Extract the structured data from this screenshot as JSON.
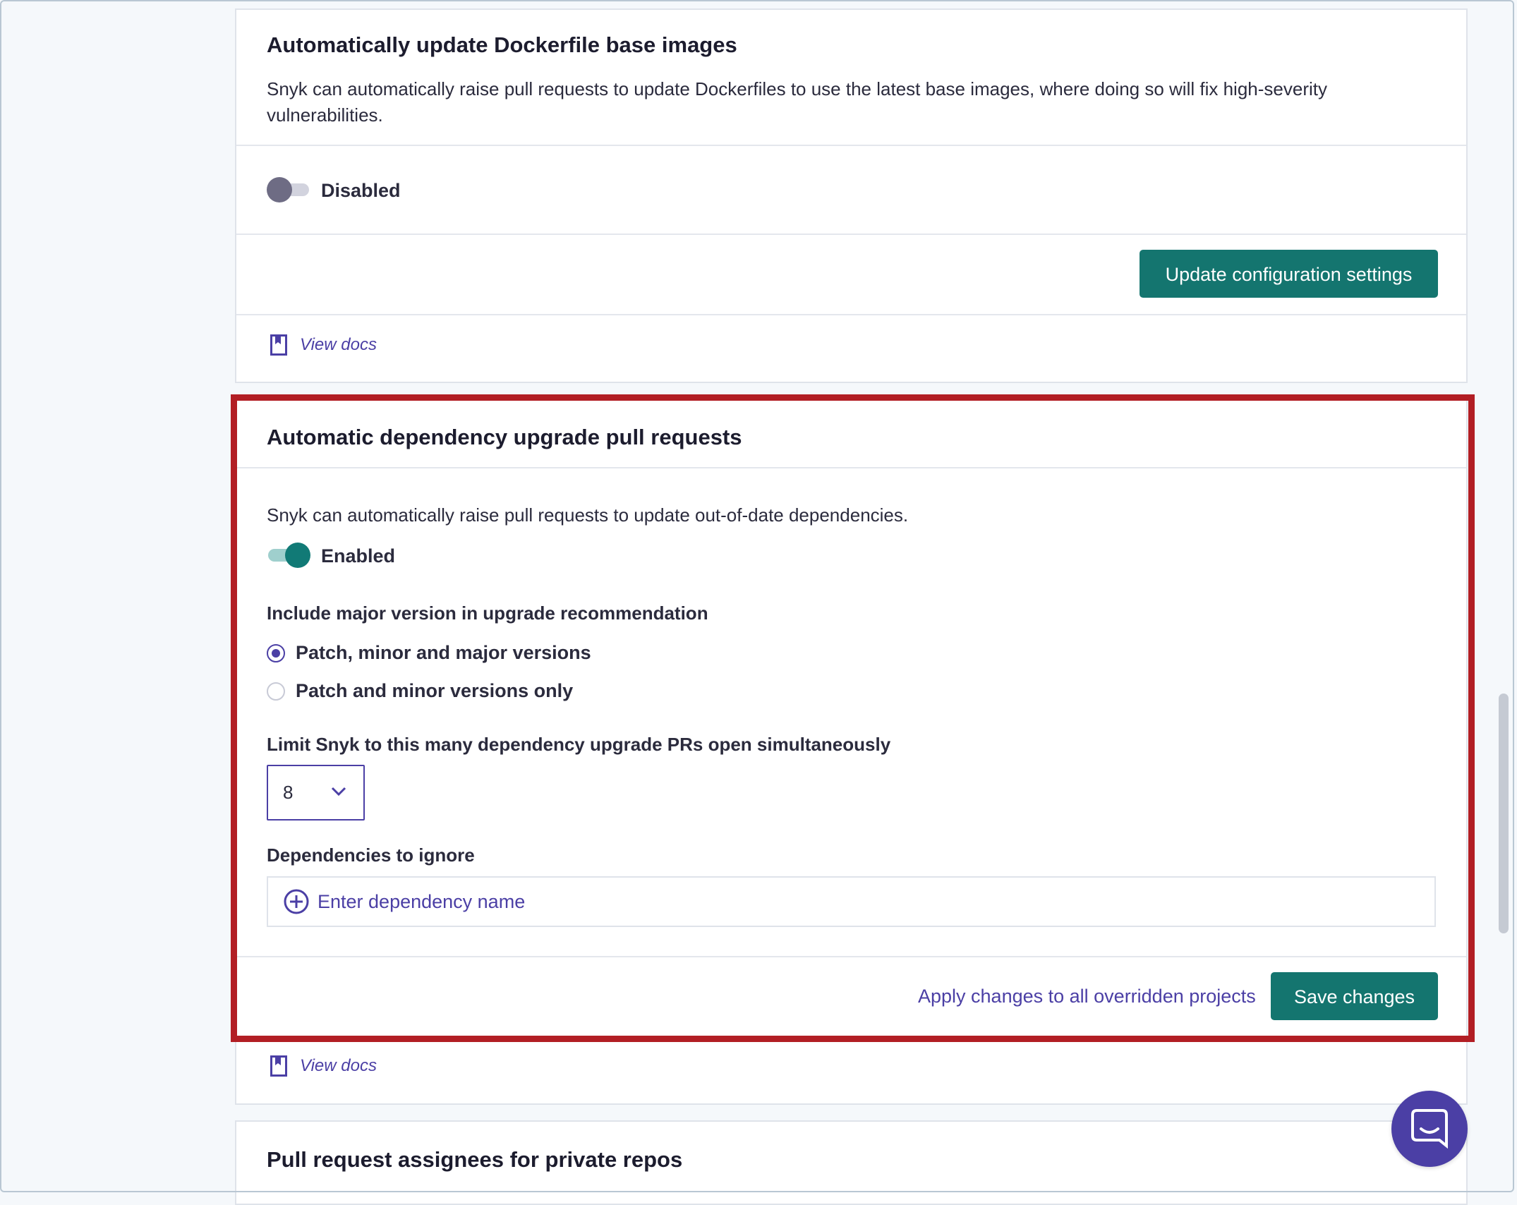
{
  "dockerfile": {
    "title": "Automatically update Dockerfile base images",
    "description": "Snyk can automatically raise pull requests to update Dockerfiles to use the latest base images, where doing so will fix high-severity vulnerabilities.",
    "toggle_state": "Disabled",
    "update_button": "Update configuration settings",
    "docs_link": "View docs"
  },
  "dependency_upgrade": {
    "title": "Automatic dependency upgrade pull requests",
    "description": "Snyk can automatically raise pull requests to update out-of-date dependencies.",
    "toggle_state": "Enabled",
    "major_version_label": "Include major version in upgrade recommendation",
    "options": [
      {
        "label": "Patch, minor and major versions",
        "selected": true
      },
      {
        "label": "Patch and minor versions only",
        "selected": false
      }
    ],
    "limit_label": "Limit Snyk to this many dependency upgrade PRs open simultaneously",
    "limit_value": "8",
    "ignore_label": "Dependencies to ignore",
    "ignore_placeholder": "Enter dependency name",
    "apply_link": "Apply changes to all overridden projects",
    "save_button": "Save changes",
    "docs_link": "View docs"
  },
  "assignees": {
    "title": "Pull request assignees for private repos"
  },
  "colors": {
    "primary_teal": "#14756f",
    "link_purple": "#4b3fa5",
    "highlight_red": "#b21e24"
  },
  "icons": {
    "docs": "book-icon",
    "dropdown": "chevron-down-icon",
    "add": "plus-circle-icon",
    "chat": "chat-icon"
  }
}
